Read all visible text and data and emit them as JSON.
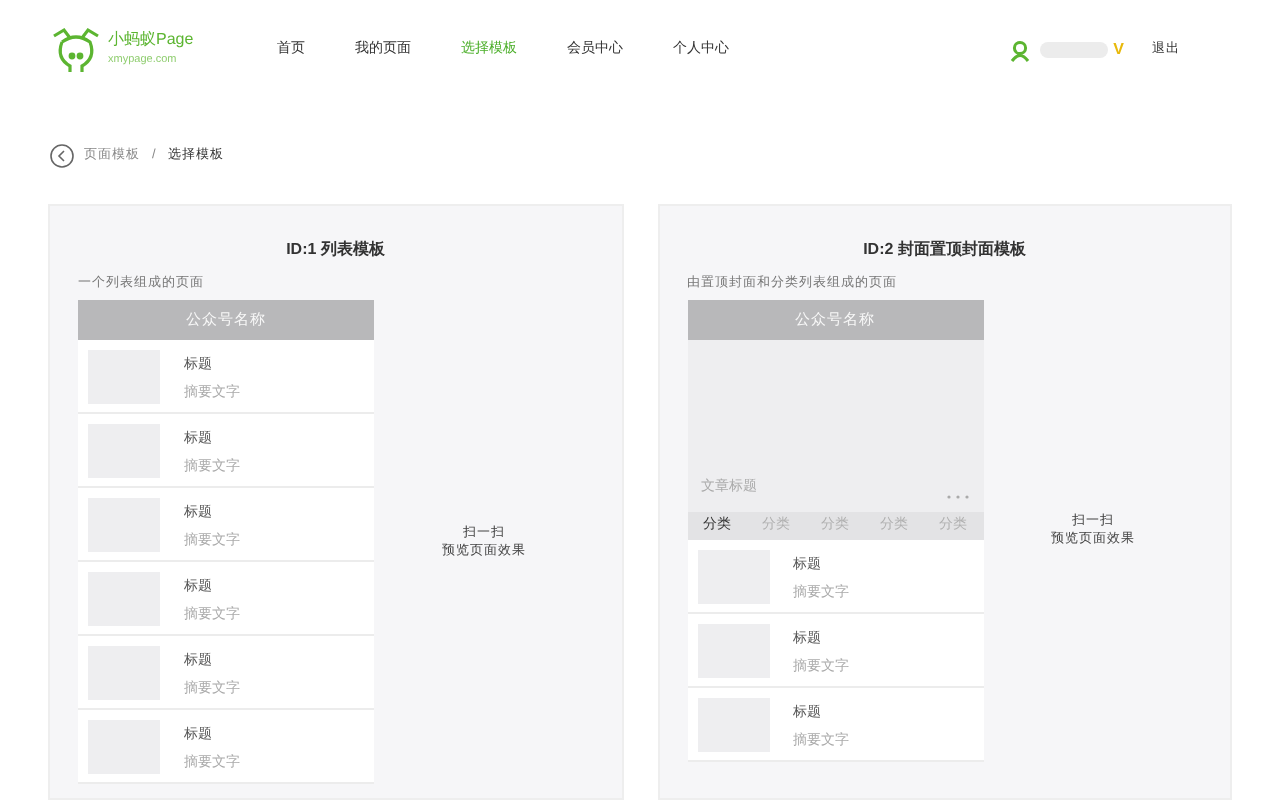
{
  "header": {
    "logo": {
      "name": "小蚂蚁Page",
      "domain": "xmypage.com"
    },
    "nav": [
      {
        "label": "首页",
        "selected": false
      },
      {
        "label": "我的页面",
        "selected": false
      },
      {
        "label": "选择模板",
        "selected": true
      },
      {
        "label": "会员中心",
        "selected": false
      },
      {
        "label": "个人中心",
        "selected": false
      }
    ],
    "user": {
      "badge": "V",
      "logout": "退出"
    }
  },
  "breadcrumb": {
    "items": [
      "页面模板",
      "选择模板"
    ],
    "separator": "/"
  },
  "templates": [
    {
      "kind": "list",
      "title": "ID:1 列表模板",
      "description": "一个列表组成的页面",
      "phone_title": "公众号名称",
      "scan": [
        "扫一扫",
        "预览页面效果"
      ],
      "items": [
        {
          "title": "标题",
          "summary": "摘要文字"
        },
        {
          "title": "标题",
          "summary": "摘要文字"
        },
        {
          "title": "标题",
          "summary": "摘要文字"
        },
        {
          "title": "标题",
          "summary": "摘要文字"
        },
        {
          "title": "标题",
          "summary": "摘要文字"
        },
        {
          "title": "标题",
          "summary": "摘要文字"
        }
      ]
    },
    {
      "kind": "cover",
      "title": "ID:2 封面置顶封面模板",
      "description": "由置顶封面和分类列表组成的页面",
      "phone_title": "公众号名称",
      "cover_title": "文章标题",
      "scan": [
        "扫一扫",
        "预览页面效果"
      ],
      "categories": [
        {
          "label": "分类",
          "selected": true
        },
        {
          "label": "分类",
          "selected": false
        },
        {
          "label": "分类",
          "selected": false
        },
        {
          "label": "分类",
          "selected": false
        },
        {
          "label": "分类",
          "selected": false
        }
      ],
      "items": [
        {
          "title": "标题",
          "summary": "摘要文字"
        },
        {
          "title": "标题",
          "summary": "摘要文字"
        },
        {
          "title": "标题",
          "summary": "摘要文字"
        }
      ]
    }
  ]
}
